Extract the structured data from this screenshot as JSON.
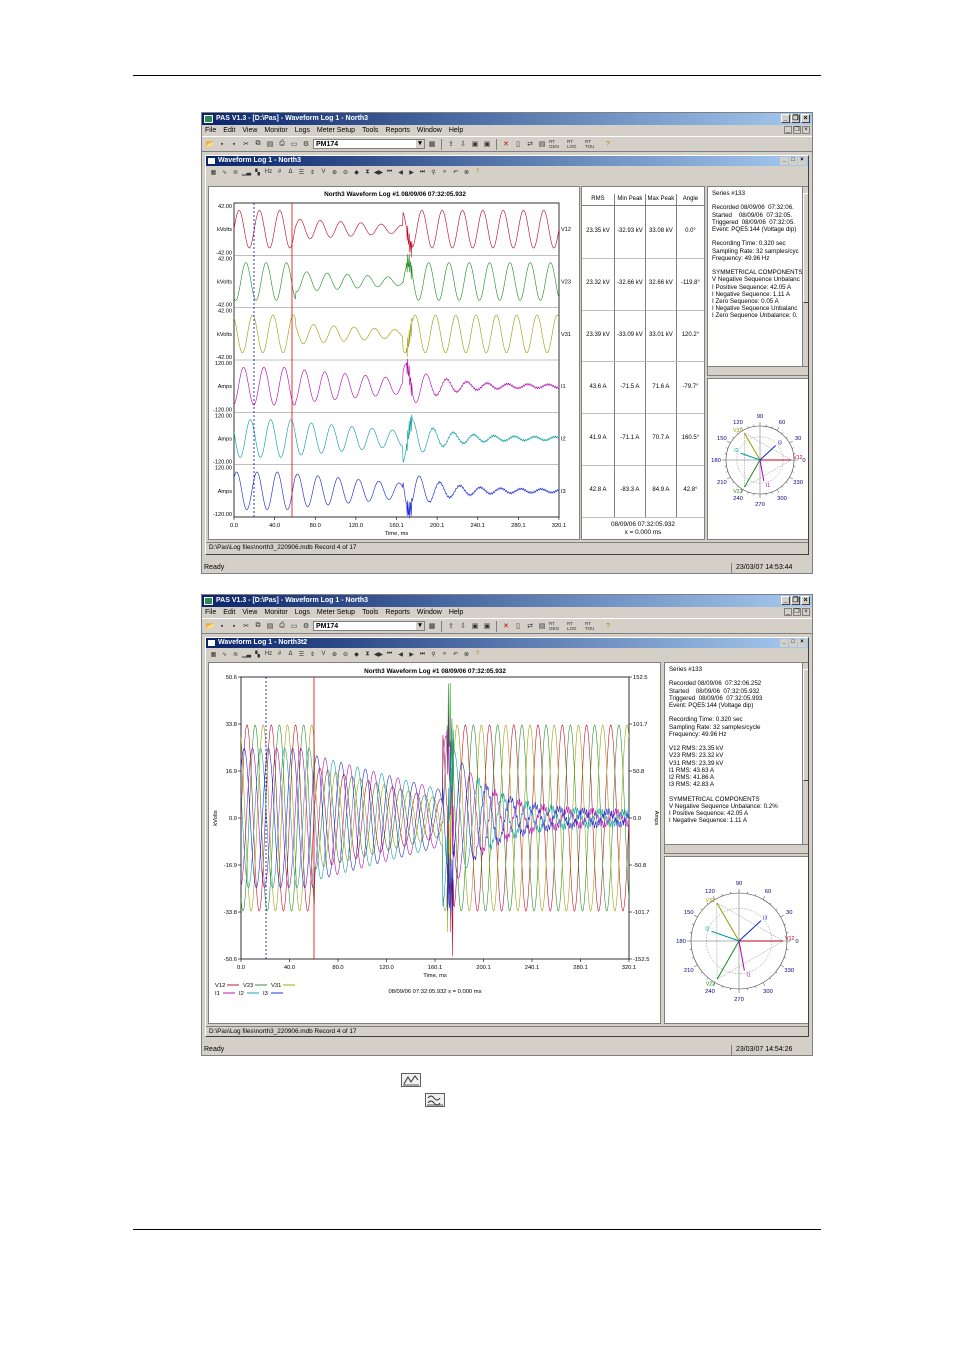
{
  "app": {
    "title": "PAS V1.3 - [D:\\Pas] - Waveform Log 1 - North3",
    "menu": [
      "File",
      "Edit",
      "View",
      "Monitor",
      "Logs",
      "Meter Setup",
      "Tools",
      "Reports",
      "Window",
      "Help"
    ],
    "device_combo": "PM174",
    "toolbar_text_buttons": [
      "RT GEN",
      "RT LOG",
      "RT TOU"
    ]
  },
  "window1": {
    "child_title": "Waveform Log 1 - North3",
    "plot_title": "North3  Waveform Log #1  08/09/06  07:32:05.932",
    "channels": [
      {
        "name": "V12",
        "unit": "kVolts",
        "top": "42.00",
        "bottom": "-42.00",
        "rms": "23.35 kV",
        "min": "-32.93 kV",
        "max": "33.08 kV",
        "angle": "0.0°",
        "color": "#c0001a"
      },
      {
        "name": "V23",
        "unit": "kVolts",
        "top": "42.00",
        "bottom": "-42.00",
        "rms": "23.32 kV",
        "min": "-32.66 kV",
        "max": "32.66 kV",
        "angle": "-119.8°",
        "color": "#1a8a1a"
      },
      {
        "name": "V31",
        "unit": "kVolts",
        "top": "42.00",
        "bottom": "-42.00",
        "rms": "23.39 kV",
        "min": "-33.09 kV",
        "max": "33.01 kV",
        "angle": "120.2°",
        "color": "#9a9a00"
      },
      {
        "name": "I1",
        "unit": "Amps",
        "top": "120.00",
        "bottom": "-120.00",
        "rms": "43.6 A",
        "min": "-71.5 A",
        "max": "71.6 A",
        "angle": "-79.7°",
        "color": "#b000b0"
      },
      {
        "name": "I2",
        "unit": "Amps",
        "top": "120.00",
        "bottom": "-120.00",
        "rms": "41.9 A",
        "min": "-71.1 A",
        "max": "70.7 A",
        "angle": "160.5°",
        "color": "#009a9a"
      },
      {
        "name": "I3",
        "unit": "Amps",
        "top": "120.00",
        "bottom": "-120.00",
        "rms": "42.8 A",
        "min": "-83.3 A",
        "max": "84.9 A",
        "angle": "42.8°",
        "color": "#1020d0"
      }
    ],
    "x_ticks": [
      "0.0",
      "40.0",
      "80.0",
      "120.0",
      "160.1",
      "200.1",
      "240.1",
      "280.1",
      "320.1"
    ],
    "x_label": "Time, ms",
    "table_headers": [
      "RMS",
      "Min Peak",
      "Max Peak",
      "Angle"
    ],
    "table_footer_time": "08/09/06  07:32:05.932",
    "table_footer_x": "x = 0.000 ms",
    "info_text": "Series #133\n\nRecorded 08/09/06  07:32:06.\nStarted    08/09/06  07:32:05.\nTriggered  08/09/06  07:32:05.\nEvent: PQE5:144 (Voltage dip)\n\nRecording Time: 0.320 sec\nSampling Rate: 32 samples/cyc\nFrequency: 49.96 Hz\n\nSYMMETRICAL COMPONENTS\nV Negative Sequence Unbalanc\nI Positive Sequence: 42.05 A\nI Negative Sequence: 1.11 A\nI Zero Sequence: 0.05 A\nI Negative Sequence Unbalanc\nI Zero Sequence Unbalance: 0.",
    "path": "D:\\Pas\\Log files\\north3_220906.mdb   Record 4 of 17",
    "status_left": "Ready",
    "status_right": "23/03/07 14:53:44"
  },
  "window2": {
    "child_title": "Waveform Log 1 - North3t2",
    "plot_title": "North3  Waveform Log #1  08/09/06  07:32:05.932",
    "y_left_ticks": [
      "50.6",
      "33.8",
      "16.9",
      "0.0",
      "-16.9",
      "-33.8",
      "-50.6"
    ],
    "y_right_ticks": [
      "152.5",
      "101.7",
      "50.8",
      "0.0",
      "-50.8",
      "-101.7",
      "-152.5"
    ],
    "y_left_label": "kVolts",
    "y_right_label": "Amps",
    "x_ticks": [
      "0.0",
      "40.0",
      "80.0",
      "120.0",
      "160.1",
      "200.1",
      "240.1",
      "280.1",
      "320.1"
    ],
    "x_label": "Time, ms",
    "legend_row1": [
      "V12",
      "V23",
      "V31"
    ],
    "legend_row2": [
      "I1",
      "I2",
      "I3"
    ],
    "cursor_text": "08/09/06  07:32:05.932   x = 0.000 ms",
    "info_text": "Series #133\n\nRecorded 08/09/06  07:32:06.252\nStarted    08/09/06  07:32:05.932\nTriggered  08/09/06  07:32:05.993\nEvent: PQE5:144 (Voltage dip)\n\nRecording Time: 0.320 sec\nSampling Rate: 32 samples/cycle\nFrequency: 49.96 Hz\n\nV12 RMS: 23.35 kV\nV23 RMS: 23.32 kV\nV31 RMS: 23.39 kV\nI1 RMS: 43.63 A\nI2 RMS: 41.86 A\nI3 RMS: 42.83 A\n\nSYMMETRICAL COMPONENTS\nV Negative Sequence Unbalance: 0.2%\nI Positive Sequence: 42.05 A\nI Negative Sequence: 1.11 A",
    "path": "D:\\Pas\\Log files\\north3_220906.mdb   Record 4 of 17",
    "status_left": "Ready",
    "status_right": "23/03/07 14:54:26"
  },
  "phasor": {
    "angle_labels": [
      "90",
      "60",
      "30",
      "0",
      "330",
      "300",
      "270",
      "240",
      "210",
      "180",
      "150",
      "120"
    ],
    "vectors": [
      {
        "name": "V12",
        "angle": 0.0,
        "mag": 1.0,
        "color": "#c0001a"
      },
      {
        "name": "V23",
        "angle": -119.8,
        "mag": 1.0,
        "color": "#1a8a1a"
      },
      {
        "name": "V31",
        "angle": 120.2,
        "mag": 1.0,
        "color": "#9a9a00"
      },
      {
        "name": "I1",
        "angle": -79.7,
        "mag": 0.68,
        "color": "#b000b0"
      },
      {
        "name": "I2",
        "angle": 160.5,
        "mag": 0.66,
        "color": "#009a9a"
      },
      {
        "name": "I3",
        "angle": 42.8,
        "mag": 0.68,
        "color": "#1020d0"
      }
    ]
  },
  "colors": {
    "v12": "#c0001a",
    "v23": "#1a8a1a",
    "v31": "#9a9a00",
    "i1": "#b000b0",
    "i2": "#009a9a",
    "i3": "#1020d0",
    "cursor_red": "#e00000",
    "cursor_blue": "#0000d0"
  }
}
